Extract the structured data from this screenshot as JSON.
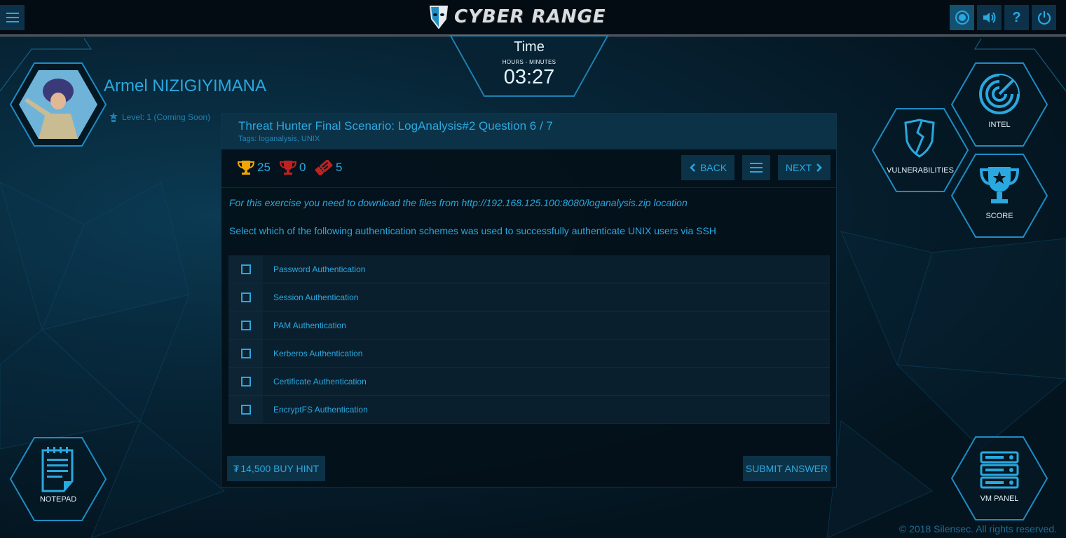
{
  "app": {
    "logo_text": "CYBER RANGE",
    "footer": "© 2018 Silensec. All rights reserved."
  },
  "timer": {
    "title": "Time",
    "subtitle": "HOURS - MINUTES",
    "value": "03:27"
  },
  "user": {
    "name": "Armel NIZIGIYIMANA",
    "level": "Level: 1 (Coming Soon)"
  },
  "side_nav": {
    "intel": "INTEL",
    "vulnerabilities": "VULNERABILITIES",
    "score": "SCORE",
    "notepad": "NOTEPAD",
    "vm_panel": "VM PANEL"
  },
  "question": {
    "title": "Threat Hunter Final Scenario: LogAnalysis#2 Question 6 / 7",
    "tags": "Tags: loganalysis, UNIX",
    "stats": {
      "points": "25",
      "penalty": "0",
      "hints": "5"
    },
    "nav": {
      "back": "BACK",
      "next": "NEXT"
    },
    "intro": "For this exercise you need to download the files from http://192.168.125.100:8080/loganalysis.zip location",
    "prompt": "Select which of the following authentication schemes was used to successfully authenticate UNIX users via SSH",
    "options": [
      "Password Authentication",
      "Session Authentication",
      "PAM Authentication",
      "Kerberos Authentication",
      "Certificate Authentication",
      "EncryptFS Authentication"
    ],
    "hint_button": "14,500 BUY HINT",
    "hint_currency": "₮",
    "submit_button": "SUBMIT ANSWER"
  },
  "colors": {
    "accent": "#2aa8e0",
    "button_bg": "#0c3247",
    "penalty": "#c0211f",
    "gold": "#f2a600"
  }
}
